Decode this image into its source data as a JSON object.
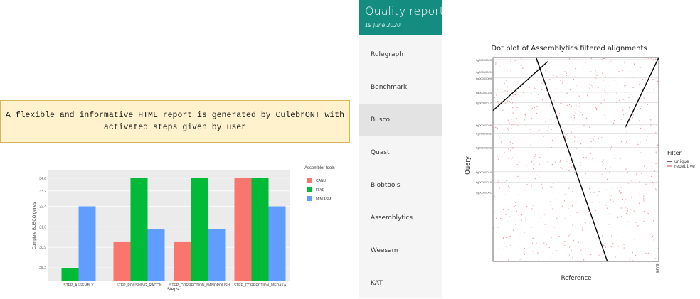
{
  "caption": "A flexible and informative HTML report is generated by CulebrONT with activated steps given by user",
  "sidebar": {
    "title": "Quality report",
    "date": "19 June 2020",
    "active_index": 2,
    "items": [
      {
        "label": "Rulegraph"
      },
      {
        "label": "Benchmark"
      },
      {
        "label": "Busco"
      },
      {
        "label": "Quast"
      },
      {
        "label": "Blobtools"
      },
      {
        "label": "Assemblytics"
      },
      {
        "label": "Weesam"
      },
      {
        "label": "KAT"
      }
    ]
  },
  "colors": {
    "sidebar_header": "#148c80",
    "canu": "#f8766d",
    "flye": "#00ba38",
    "minasm": "#619cff",
    "unique": "#000000",
    "repetitive": "#e8a0a0"
  },
  "chart_data": [
    {
      "type": "bar",
      "title": "",
      "xlabel": "Steps",
      "ylabel": "Complete BUSCO genes",
      "categories": [
        "STEP_ASSEMBLY",
        "STEP_POLISHING_RACON",
        "STEP_CORRECTION_NANOPOLISH",
        "STEP_CORRECTION_MEDAKA"
      ],
      "y_ticks": [
        "28.2",
        "30.9",
        "31.6",
        "32.4",
        "33.2",
        "34.0"
      ],
      "legend_title": "Assembler tools",
      "legend_position": "right",
      "grid": true,
      "series": [
        {
          "name": "CANU",
          "values": [
            null,
            1.5,
            1.5,
            4
          ]
        },
        {
          "name": "FLYE",
          "values": [
            0.5,
            4,
            4,
            4
          ]
        },
        {
          "name": "MINIASM",
          "values": [
            2.9,
            2.0,
            2.0,
            2.9
          ]
        }
      ]
    },
    {
      "type": "scatter",
      "title": "Dot plot of Assemblytics filtered alignments",
      "xlabel": "Reference",
      "ylabel": "Query",
      "x_ticks": [
        "BAK5"
      ],
      "y_ticks": [
        "tig00000003",
        "tig00000021",
        "tig00000009",
        "tig00000024",
        "tig00000017",
        "tig00000026",
        "tig00000011",
        "tig00000033",
        "tig00000014",
        "tig00000016",
        "tig00000001"
      ],
      "legend_title": "Filter",
      "legend_position": "right",
      "legend": [
        "unique",
        "repetitive"
      ],
      "grid": false,
      "series": [
        {
          "name": "unique",
          "segments": [
            [
              0.0,
              0.33,
              0.26,
              0.02
            ],
            [
              0.26,
              0.69,
              0.0,
              1.0
            ],
            [
              0.8,
              1.0,
              0.34,
              0.0
            ]
          ]
        },
        {
          "name": "repetitive",
          "note": ""
        }
      ]
    }
  ]
}
